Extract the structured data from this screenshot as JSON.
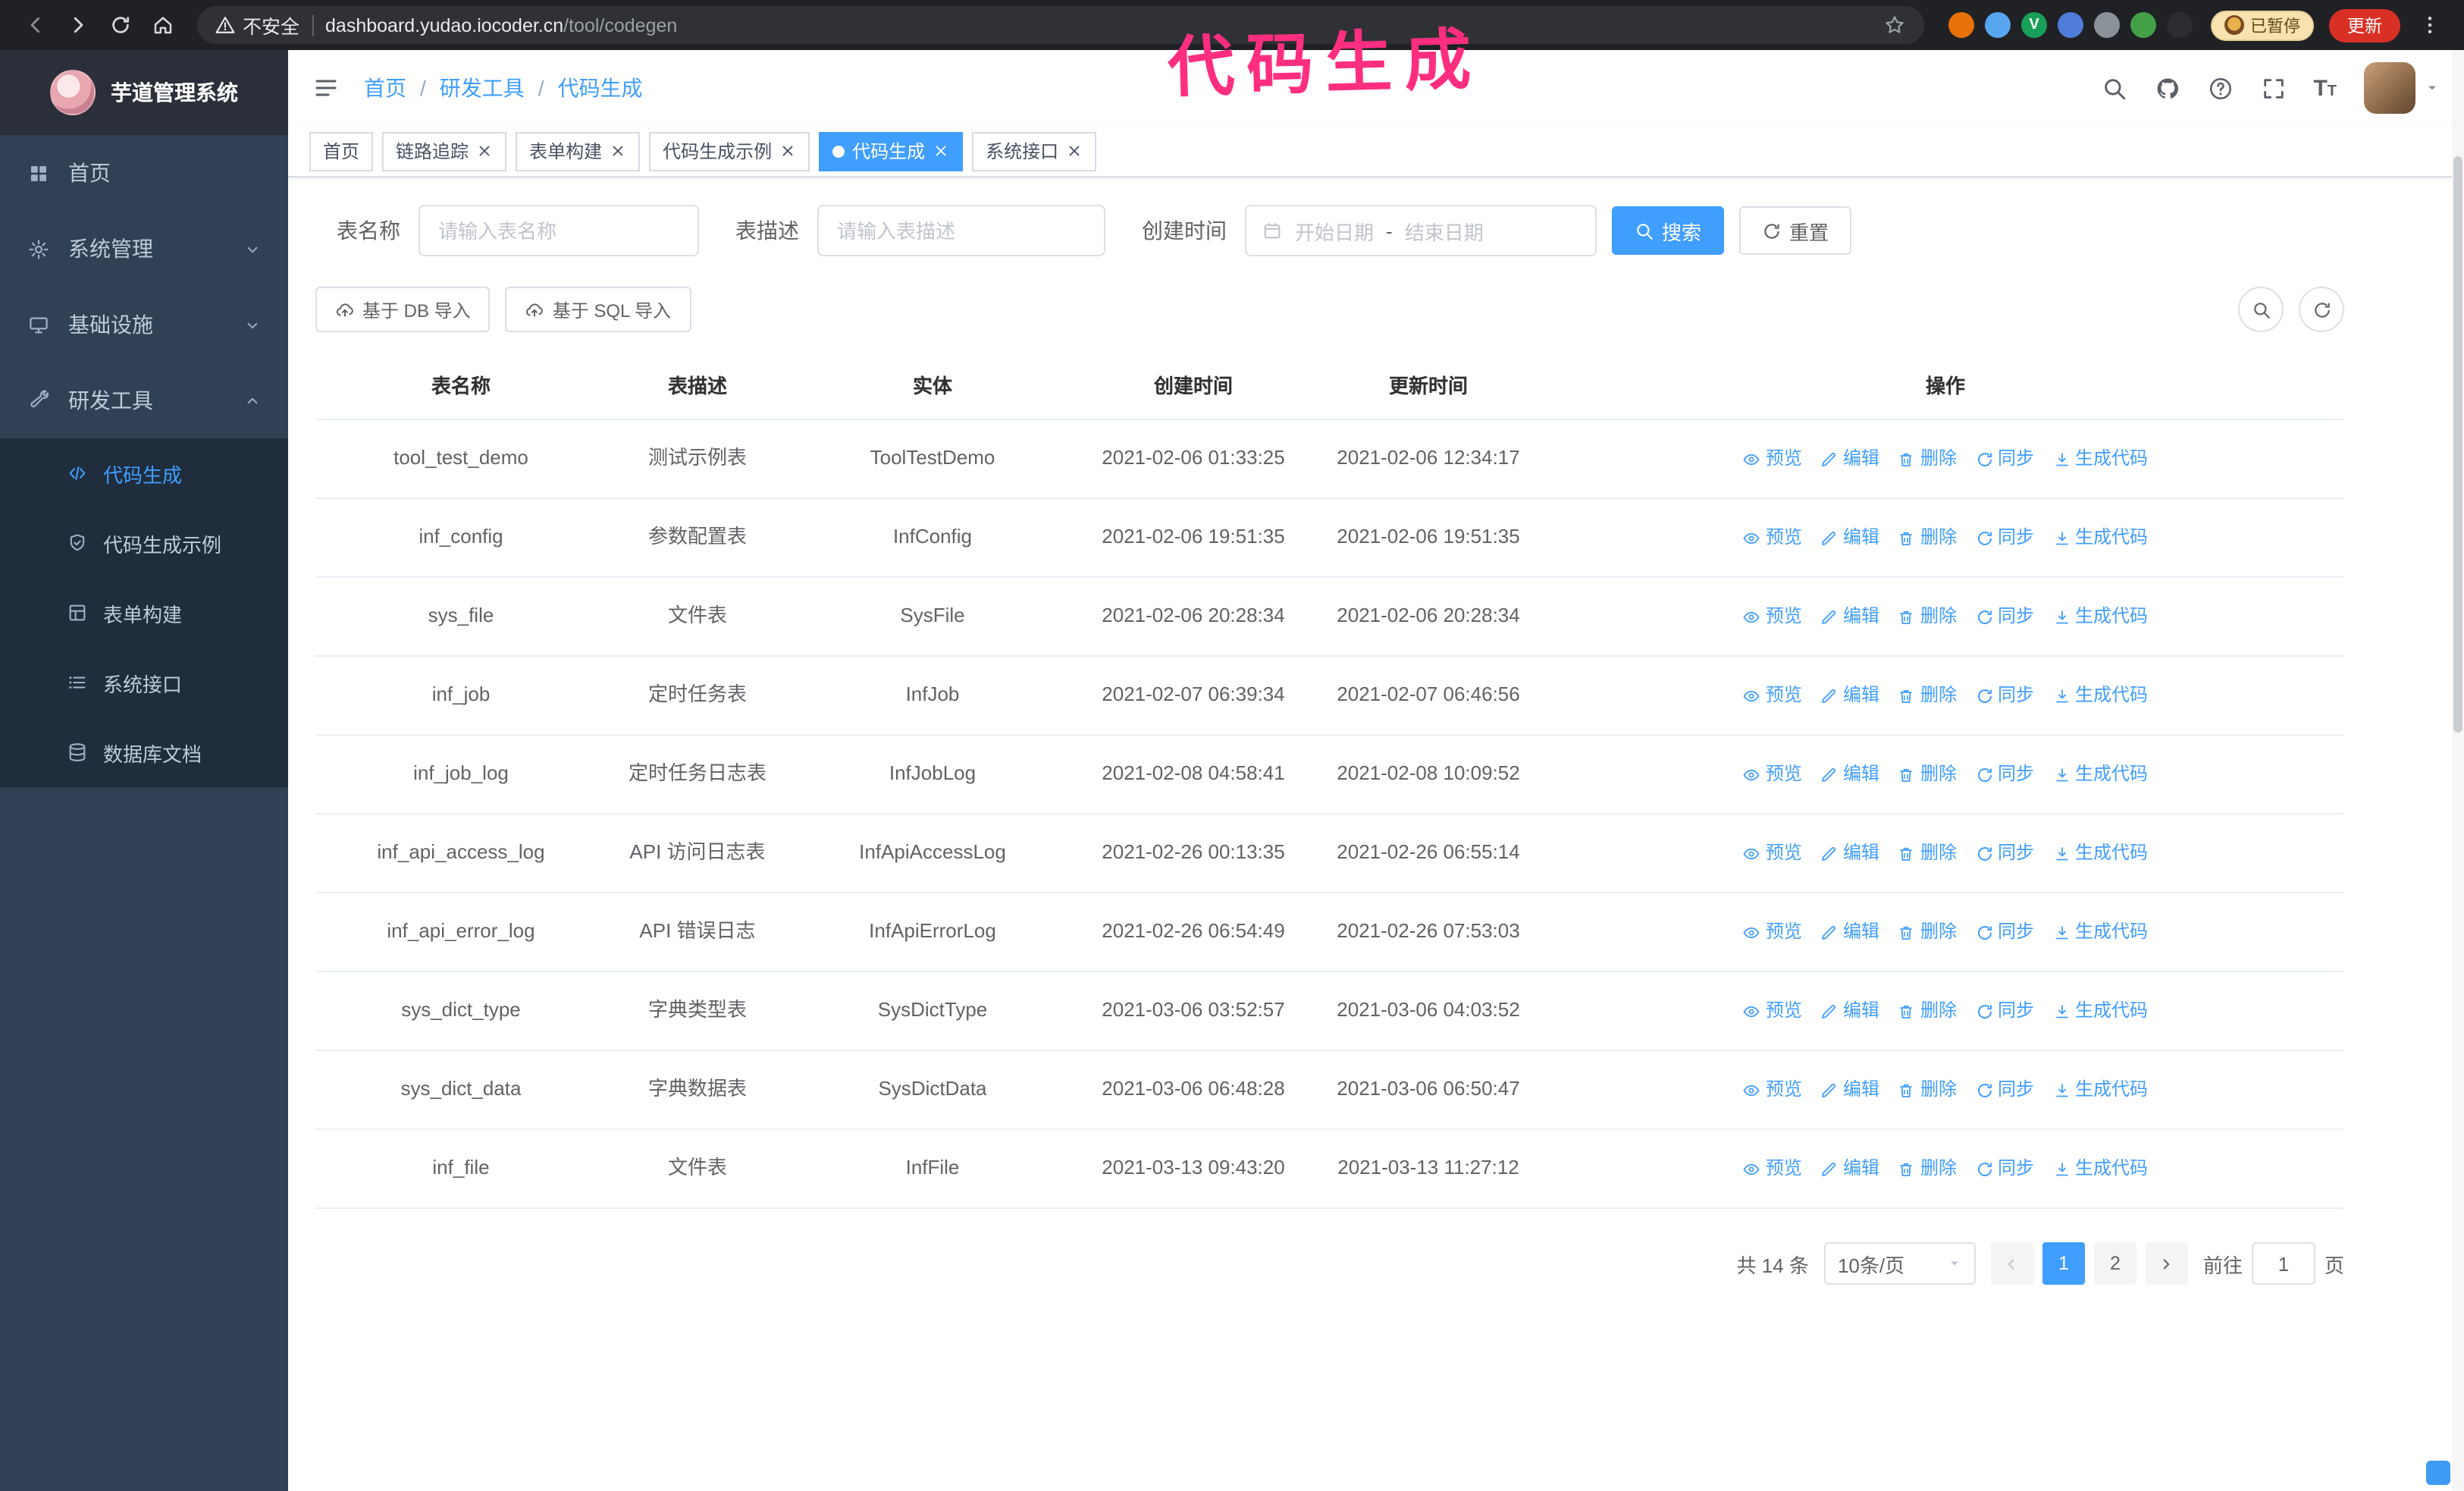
{
  "annotation": {
    "text": "代码生成",
    "color": "#ff2e7f"
  },
  "browser": {
    "security_label": "不安全",
    "url_host": "dashboard.yudao.iocoder.cn",
    "url_path": "/tool/codegen",
    "paused_badge": "已暂停",
    "update_button": "更新",
    "extensions": [
      {
        "name": "extension-orange-icon",
        "color": "#e8710a"
      },
      {
        "name": "extension-drop-icon",
        "color": "#58a6f0"
      },
      {
        "name": "extension-v-icon",
        "color": "#18a058",
        "glyph": "V"
      },
      {
        "name": "extension-people-icon",
        "color": "#4e7cd8"
      },
      {
        "name": "extension-gray-icon",
        "color": "#8a9199"
      },
      {
        "name": "extension-leaf-icon",
        "color": "#43a047"
      },
      {
        "name": "extension-paw-icon",
        "color": "#2b2d30"
      }
    ]
  },
  "sidebar": {
    "logo_title": "芋道管理系统",
    "menu": [
      {
        "key": "home",
        "label": "首页",
        "icon": "dashboard-icon",
        "expandable": false,
        "expanded": false
      },
      {
        "key": "system",
        "label": "系统管理",
        "icon": "gear-icon",
        "expandable": true,
        "expanded": false
      },
      {
        "key": "infra",
        "label": "基础设施",
        "icon": "infra-icon",
        "expandable": true,
        "expanded": false
      },
      {
        "key": "devtools",
        "label": "研发工具",
        "icon": "tools-icon",
        "expandable": true,
        "expanded": true
      }
    ],
    "submenu": [
      {
        "key": "codegen",
        "label": "代码生成",
        "icon": "code-icon",
        "active": true
      },
      {
        "key": "codegen-example",
        "label": "代码生成示例",
        "icon": "example-icon",
        "active": false
      },
      {
        "key": "form-builder",
        "label": "表单构建",
        "icon": "form-icon",
        "active": false
      },
      {
        "key": "system-api",
        "label": "系统接口",
        "icon": "api-icon",
        "active": false
      },
      {
        "key": "db-doc",
        "label": "数据库文档",
        "icon": "database-icon",
        "active": false
      }
    ]
  },
  "header": {
    "breadcrumbs": [
      "首页",
      "研发工具",
      "代码生成"
    ],
    "breadcrumb_separator": "/"
  },
  "icons": {
    "font_size_large": "T",
    "font_size_small": "T"
  },
  "tags": [
    {
      "label": "首页",
      "closable": false,
      "active": false
    },
    {
      "label": "链路追踪",
      "closable": true,
      "active": false
    },
    {
      "label": "表单构建",
      "closable": true,
      "active": false
    },
    {
      "label": "代码生成示例",
      "closable": true,
      "active": false
    },
    {
      "label": "代码生成",
      "closable": true,
      "active": true
    },
    {
      "label": "系统接口",
      "closable": true,
      "active": false
    }
  ],
  "filters": {
    "table_name_label": "表名称",
    "table_name_placeholder": "请输入表名称",
    "table_desc_label": "表描述",
    "table_desc_placeholder": "请输入表描述",
    "create_time_label": "创建时间",
    "date_start_placeholder": "开始日期",
    "date_separator": "-",
    "date_end_placeholder": "结束日期",
    "search_button": "搜索",
    "reset_button": "重置"
  },
  "toolbar": {
    "import_db_button": "基于 DB 导入",
    "import_sql_button": "基于 SQL 导入"
  },
  "table": {
    "columns": [
      "表名称",
      "表描述",
      "实体",
      "创建时间",
      "更新时间",
      "操作"
    ],
    "op_labels": [
      "预览",
      "编辑",
      "删除",
      "同步",
      "生成代码"
    ],
    "op_keys": [
      "preview",
      "edit",
      "delete",
      "sync",
      "generate-code"
    ],
    "op_icons": [
      "eye-icon",
      "edit-icon",
      "trash-icon",
      "sync-icon",
      "download-icon"
    ],
    "rows": [
      {
        "name": "tool_test_demo",
        "desc": "测试示例表",
        "entity": "ToolTestDemo",
        "created": "2021-02-06 01:33:25",
        "updated": "2021-02-06 12:34:17"
      },
      {
        "name": "inf_config",
        "desc": "参数配置表",
        "entity": "InfConfig",
        "created": "2021-02-06 19:51:35",
        "updated": "2021-02-06 19:51:35"
      },
      {
        "name": "sys_file",
        "desc": "文件表",
        "entity": "SysFile",
        "created": "2021-02-06 20:28:34",
        "updated": "2021-02-06 20:28:34"
      },
      {
        "name": "inf_job",
        "desc": "定时任务表",
        "entity": "InfJob",
        "created": "2021-02-07 06:39:34",
        "updated": "2021-02-07 06:46:56"
      },
      {
        "name": "inf_job_log",
        "desc": "定时任务日志表",
        "entity": "InfJobLog",
        "created": "2021-02-08 04:58:41",
        "updated": "2021-02-08 10:09:52"
      },
      {
        "name": "inf_api_access_log",
        "desc": "API 访问日志表",
        "entity": "InfApiAccessLog",
        "created": "2021-02-26 00:13:35",
        "updated": "2021-02-26 06:55:14"
      },
      {
        "name": "inf_api_error_log",
        "desc": "API 错误日志",
        "entity": "InfApiErrorLog",
        "created": "2021-02-26 06:54:49",
        "updated": "2021-02-26 07:53:03"
      },
      {
        "name": "sys_dict_type",
        "desc": "字典类型表",
        "entity": "SysDictType",
        "created": "2021-03-06 03:52:57",
        "updated": "2021-03-06 04:03:52"
      },
      {
        "name": "sys_dict_data",
        "desc": "字典数据表",
        "entity": "SysDictData",
        "created": "2021-03-06 06:48:28",
        "updated": "2021-03-06 06:50:47"
      },
      {
        "name": "inf_file",
        "desc": "文件表",
        "entity": "InfFile",
        "created": "2021-03-13 09:43:20",
        "updated": "2021-03-13 11:27:12"
      }
    ]
  },
  "pagination": {
    "total_text": "共 14 条",
    "page_size_value": "10条/页",
    "pages": [
      "1",
      "2"
    ],
    "active_page": "1",
    "goto_label": "前往",
    "goto_value": "1",
    "goto_suffix": "页"
  },
  "colors": {
    "primary": "#409eff",
    "sidebar_bg": "#304156",
    "submenu_bg": "#1f2d3d"
  }
}
